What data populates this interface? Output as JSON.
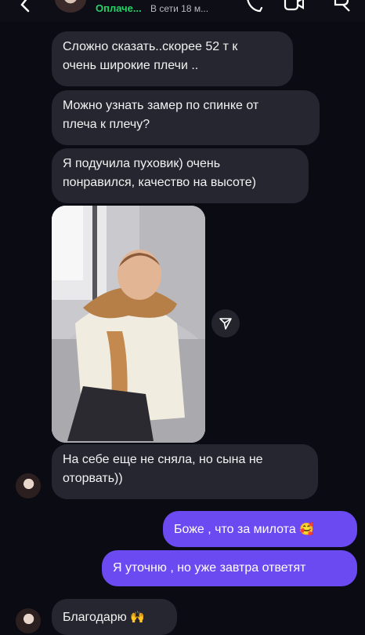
{
  "header": {
    "contact_name": "Оплаче...",
    "status": "В сети 18 м...",
    "icons": [
      "back-icon",
      "avatar",
      "phone-icon",
      "video-icon",
      "flag-icon"
    ]
  },
  "messages": {
    "m1": {
      "line1": "Сложно сказать..скорее 52 т к",
      "line2": "очень широкие плечи .."
    },
    "m2": {
      "line1": "Можно узнать замер по спинке от",
      "line2": "плеча к плечу?"
    },
    "m3": {
      "line1": "Я подучила пуховик) очень",
      "line2": "понравился, качество на высоте)"
    },
    "m4": {
      "line1": "На себе еще не сняла, но сына не",
      "line2": "оторвать))"
    },
    "m5": {
      "text": "Боже , что за милота",
      "emoji": "🥰"
    },
    "m6": {
      "text": "Я уточню , но уже завтра ответят"
    },
    "m7": {
      "text": "Благодарю",
      "emoji": "🙌"
    }
  },
  "colors": {
    "background": "#0b0b14",
    "incoming_bubble": "#262630",
    "outgoing_bubble": "#6b4af2",
    "status_green": "#25d366"
  }
}
